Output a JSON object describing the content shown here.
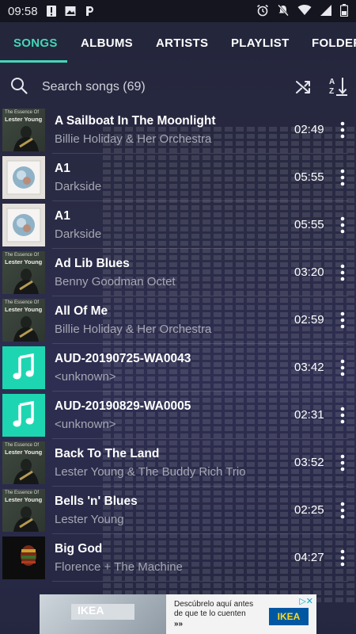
{
  "status_bar": {
    "time": "09:58",
    "left_icons": [
      "alert-icon",
      "image-icon",
      "p-icon"
    ],
    "right_icons": [
      "alarm-icon",
      "mute-icon",
      "wifi-icon",
      "signal-icon",
      "battery-icon"
    ]
  },
  "tabs": [
    {
      "label": "SONGS",
      "active": true
    },
    {
      "label": "ALBUMS",
      "active": false
    },
    {
      "label": "ARTISTS",
      "active": false
    },
    {
      "label": "PLAYLIST",
      "active": false
    },
    {
      "label": "FOLDER",
      "active": false
    }
  ],
  "search": {
    "label": "Search songs (69)"
  },
  "songs": [
    {
      "title": "A Sailboat In The Moonlight",
      "artist": "Billie Holiday & Her Orchestra",
      "duration": "02:49",
      "cover": "lester"
    },
    {
      "title": "A1",
      "artist": "Darkside",
      "duration": "05:55",
      "cover": "darkside"
    },
    {
      "title": "A1",
      "artist": "Darkside",
      "duration": "05:55",
      "cover": "darkside"
    },
    {
      "title": "Ad Lib Blues",
      "artist": "Benny Goodman Octet",
      "duration": "03:20",
      "cover": "lester"
    },
    {
      "title": "All Of Me",
      "artist": "Billie Holiday & Her Orchestra",
      "duration": "02:59",
      "cover": "lester"
    },
    {
      "title": "AUD-20190725-WA0043",
      "artist": "<unknown>",
      "duration": "03:42",
      "cover": "music"
    },
    {
      "title": "AUD-20190829-WA0005",
      "artist": "<unknown>",
      "duration": "02:31",
      "cover": "music"
    },
    {
      "title": "Back To The Land",
      "artist": "Lester Young & The Buddy Rich Trio",
      "duration": "03:52",
      "cover": "lester"
    },
    {
      "title": "Bells 'n' Blues",
      "artist": "Lester Young",
      "duration": "02:25",
      "cover": "lester"
    },
    {
      "title": "Big God",
      "artist": "Florence + The Machine",
      "duration": "04:27",
      "cover": "god"
    }
  ],
  "cover_text": {
    "lester_line1": "The Essence Of",
    "lester_line2": "Lester Young"
  },
  "ad": {
    "line1": "Descúbrelo aquí antes",
    "line2": "de que te lo cuenten",
    "arrows": "»»",
    "brand": "IKEA"
  },
  "colors": {
    "accent": "#43d7b6",
    "music_tile": "#1dd6b1"
  }
}
